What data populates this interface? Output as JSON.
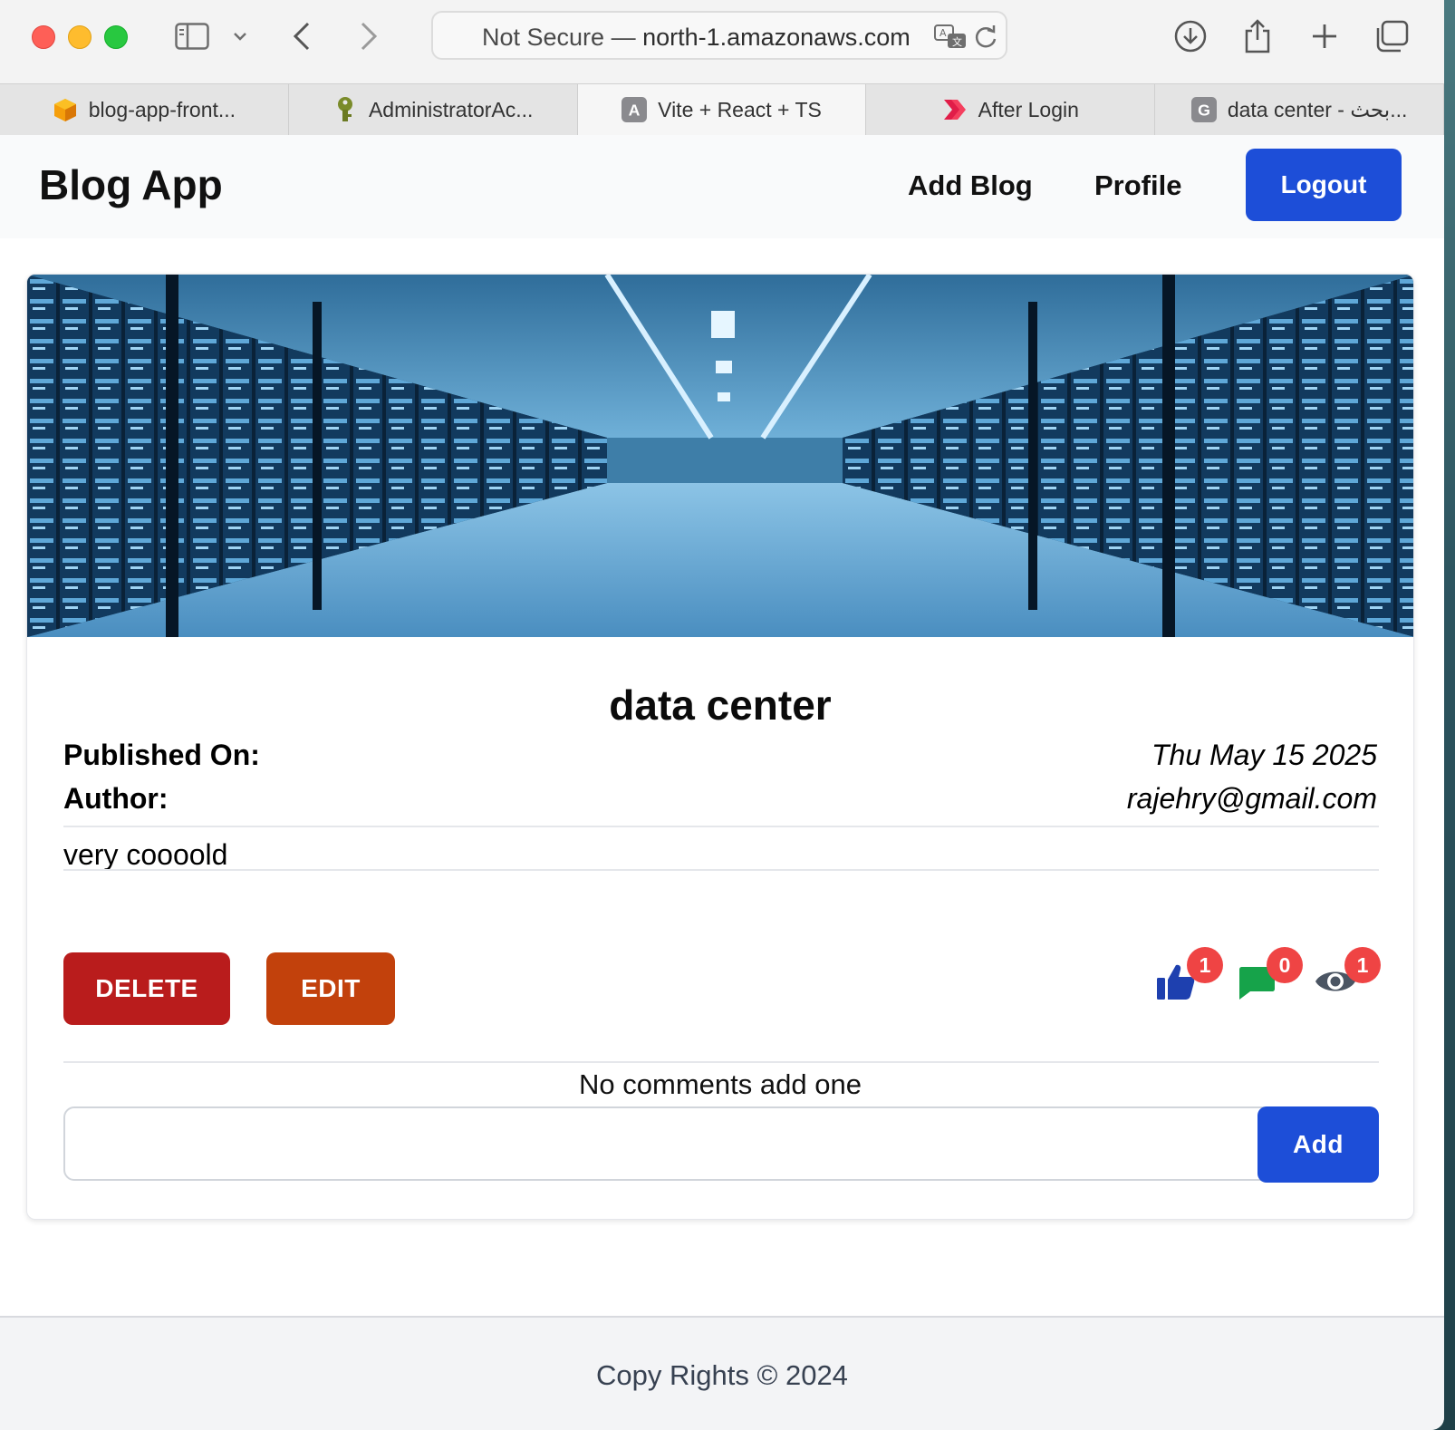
{
  "browser": {
    "url_prefix": "Not Secure — ",
    "url_host": "north-1.amazonaws.com",
    "tabs": [
      {
        "label": "blog-app-front...",
        "icon": "aws-cube-icon"
      },
      {
        "label": "AdministratorAc...",
        "icon": "key-icon"
      },
      {
        "label": "Vite + React + TS",
        "icon": "letter-a-icon",
        "favicon_letter": "A"
      },
      {
        "label": "After Login",
        "icon": "chevrons-icon"
      },
      {
        "label": "data center - بحث...",
        "icon": "letter-g-icon",
        "favicon_letter": "G"
      }
    ],
    "active_tab": 2
  },
  "nav": {
    "brand": "Blog App",
    "links": [
      "Add Blog",
      "Profile"
    ],
    "logout_label": "Logout"
  },
  "post": {
    "image_alt": "data center corridor with server racks",
    "title": "data center",
    "published_label": "Published On:",
    "published_value": "Thu May 15 2025",
    "author_label": "Author:",
    "author_value": "rajehry@gmail.com",
    "body": "very coooold",
    "delete_label": "DELETE",
    "edit_label": "EDIT",
    "stats": {
      "likes": "1",
      "comments": "0",
      "views": "1"
    },
    "no_comments_text": "No comments add one",
    "comment_placeholder": "",
    "add_label": "Add"
  },
  "footer": {
    "text": "Copy Rights © 2024"
  },
  "colors": {
    "primary": "#1d4ed8",
    "delete": "#b91c1c",
    "edit": "#c2410c",
    "badge": "#ef4444",
    "like_icon": "#1e40af",
    "comment_icon": "#16a34a",
    "view_icon": "#4b5563"
  }
}
